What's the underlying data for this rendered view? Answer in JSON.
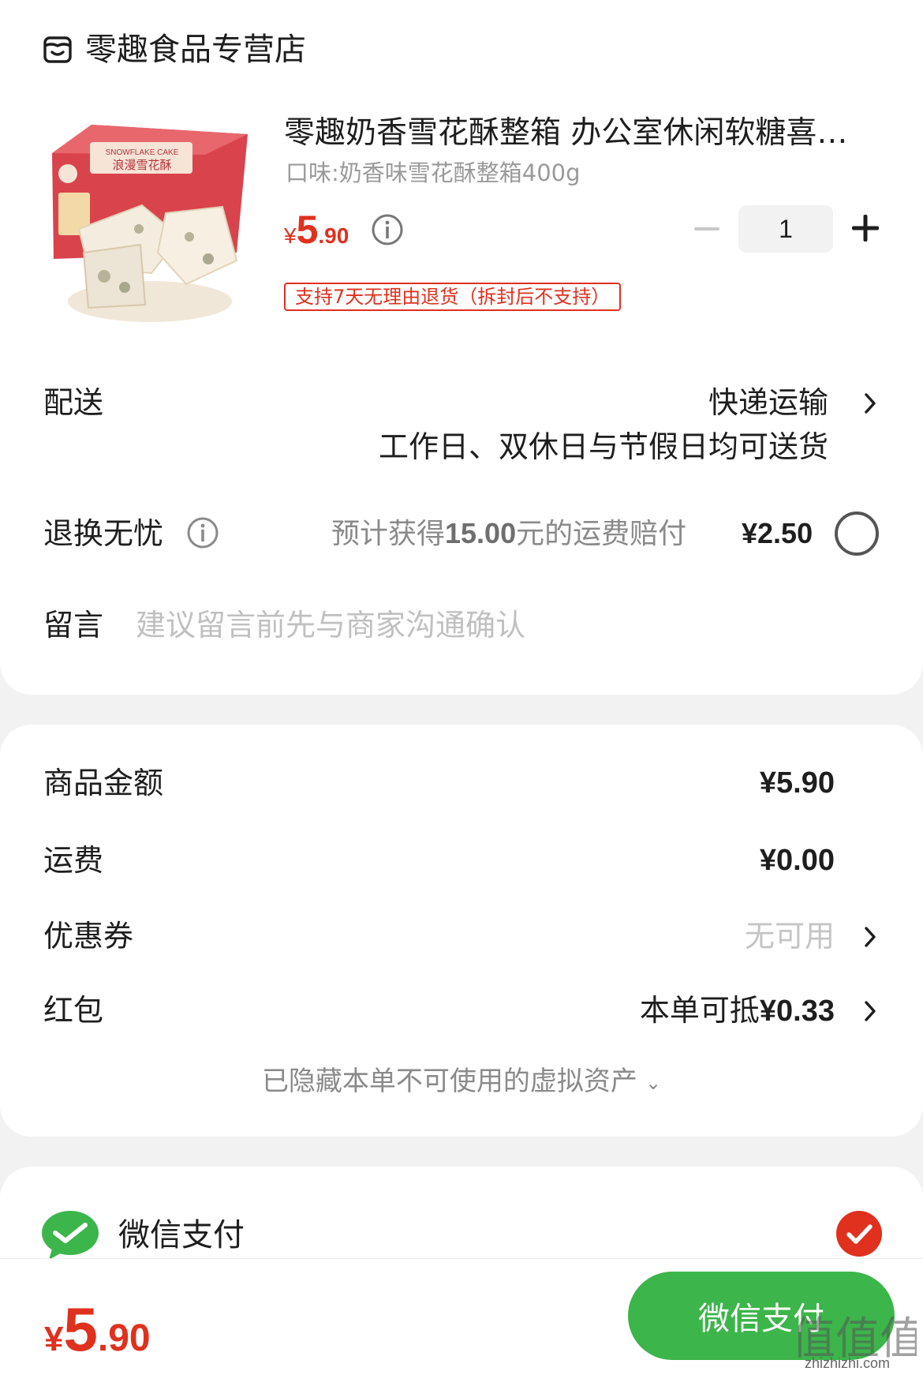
{
  "store": {
    "name": "零趣食品专营店",
    "icon": "store-icon"
  },
  "product": {
    "title": "零趣奶香雪花酥整箱 办公室休闲软糖喜…",
    "variant": "口味:奶香味雪花酥整箱400g",
    "price_symbol": "¥",
    "price_int": "5",
    "price_dec": ".90",
    "quantity": "1",
    "return_policy": "支持7天无理由退货（拆封后不支持）",
    "image_text": "SNOWFLAKE CAKE 浪漫雪花酥"
  },
  "delivery": {
    "label": "配送",
    "method": "快递运输",
    "note": "工作日、双休日与节假日均可送货"
  },
  "return_insurance": {
    "label": "退换无忧",
    "desc_prefix": "预计获得",
    "desc_amount": "15.00",
    "desc_suffix": "元的运费赔付",
    "price": "¥2.50",
    "selected": false
  },
  "message": {
    "label": "留言",
    "placeholder": "建议留言前先与商家沟通确认"
  },
  "summary": {
    "goods_label": "商品金额",
    "goods_value": "¥5.90",
    "shipping_label": "运费",
    "shipping_value": "¥0.00",
    "coupon_label": "优惠券",
    "coupon_value": "无可用",
    "redpacket_label": "红包",
    "redpacket_prefix": "本单可抵",
    "redpacket_amount": "¥0.33",
    "hidden_assets": "已隐藏本单不可使用的虚拟资产"
  },
  "payment": {
    "method": "微信支付",
    "selected": true
  },
  "bottom": {
    "total_symbol": "¥",
    "total_int": "5",
    "total_dec": ".90",
    "pay_button": "微信支付",
    "watermark": "值值值",
    "watermark_url": "zhizhizhi.com"
  },
  "colors": {
    "accent_red": "#e0301e",
    "wechat_green": "#3cb54a",
    "background": "#f2f2f2"
  }
}
